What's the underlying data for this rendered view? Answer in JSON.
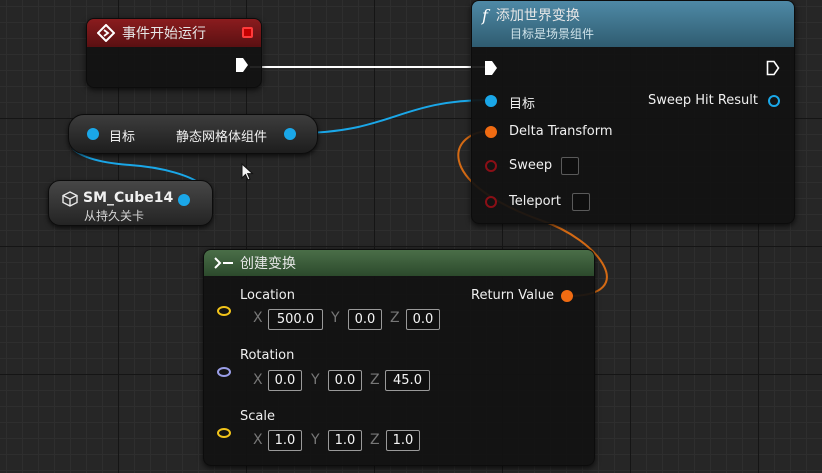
{
  "event_node": {
    "title": "事件开始运行"
  },
  "add_transform_node": {
    "title": "添加世界变换",
    "subtitle": "目标是场景组件",
    "inputs": {
      "target": "目标",
      "delta": "Delta Transform",
      "sweep": "Sweep",
      "teleport": "Teleport"
    },
    "outputs": {
      "sweep_hit": "Sweep Hit Result"
    }
  },
  "getter_node": {
    "input_label": "目标",
    "output_label": "静态网格体组件"
  },
  "cube_node": {
    "title": "SM_Cube14",
    "subtitle": "从持久关卡"
  },
  "make_transform_node": {
    "title": "创建变换",
    "return_label": "Return Value",
    "location": {
      "label": "Location",
      "x": "500.0",
      "y": "0.0",
      "z": "0.0"
    },
    "rotation": {
      "label": "Rotation",
      "x": "0.0",
      "y": "0.0",
      "z": "45.0"
    },
    "scale": {
      "label": "Scale",
      "x": "1.0",
      "y": "1.0",
      "z": "1.0"
    }
  },
  "axis_labels": {
    "x": "X",
    "y": "Y",
    "z": "Z"
  },
  "colors": {
    "object_pin": "#1aa7e8",
    "transform_pin": "#f06b12",
    "bool_pin": "#8a0f16",
    "vector_pin": "#f2c41a",
    "rotator_pin": "#9a9ee8",
    "event_header": "#7a1618",
    "function_header": "#3f6f86",
    "pure_header": "#3a5a38",
    "exec_wire": "#ffffff"
  }
}
